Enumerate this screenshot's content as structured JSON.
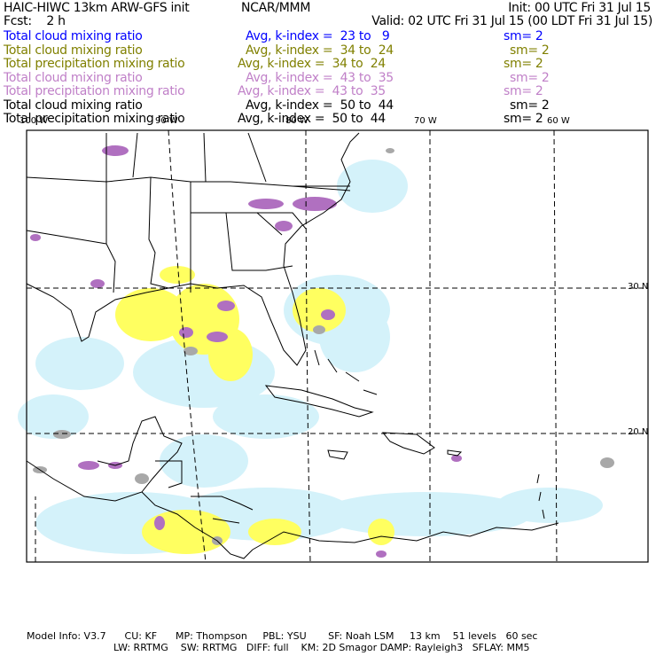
{
  "header": {
    "title": "HAIC-HIWC 13km ARW-GFS init",
    "org": "NCAR/MMM",
    "init": "Init: 00 UTC Fri 31 Jul 15",
    "fcst": "Fcst:    2 h",
    "valid": "Valid: 02 UTC Fri 31 Jul 15 (00 LDT Fri 31 Jul 15)"
  },
  "legend": [
    {
      "field": "Total cloud mixing ratio",
      "avg": "Avg, k-index =  23 to   9",
      "sm": "sm= 2",
      "color": "#0000ff"
    },
    {
      "field": "Total cloud mixing ratio",
      "avg": "Avg, k-index =  34 to  24",
      "sm": "sm= 2",
      "color": "#808000"
    },
    {
      "field": "Total precipitation mixing ratio",
      "avg": "Avg, k-index =  34 to  24",
      "sm": "sm= 2",
      "color": "#808000"
    },
    {
      "field": "Total cloud mixing ratio",
      "avg": "Avg, k-index =  43 to  35",
      "sm": "sm= 2",
      "color": "#c080c8"
    },
    {
      "field": "Total precipitation mixing ratio",
      "avg": "Avg, k-index =  43 to  35",
      "sm": "sm= 2",
      "color": "#c080c8"
    },
    {
      "field": "Total cloud mixing ratio",
      "avg": "Avg, k-index =  50 to  44",
      "sm": "sm= 2",
      "color": "#000000"
    },
    {
      "field": "Total precipitation mixing ratio",
      "avg": "Avg, k-index =  50 to  44",
      "sm": "sm= 2",
      "color": "#000000"
    }
  ],
  "map": {
    "lon_labels": [
      "100 W",
      "90 W",
      "80 W",
      "70 W",
      "60 W"
    ],
    "lat_labels": [
      "30 N",
      "20 N"
    ],
    "colors": {
      "light": "#d4f2fa",
      "yellow": "#ffff60",
      "purple": "#b070c0",
      "gray": "#a8a8a8"
    }
  },
  "footer": {
    "line1": "Model Info: V3.7      CU: KF      MP: Thompson     PBL: YSU       SF: Noah LSM     13 km    51 levels   60 sec",
    "line2": "LW: RRTMG    SW: RRTMG   DIFF: full    KM: 2D Smagor DAMP: Rayleigh3   SFLAY: MM5"
  }
}
